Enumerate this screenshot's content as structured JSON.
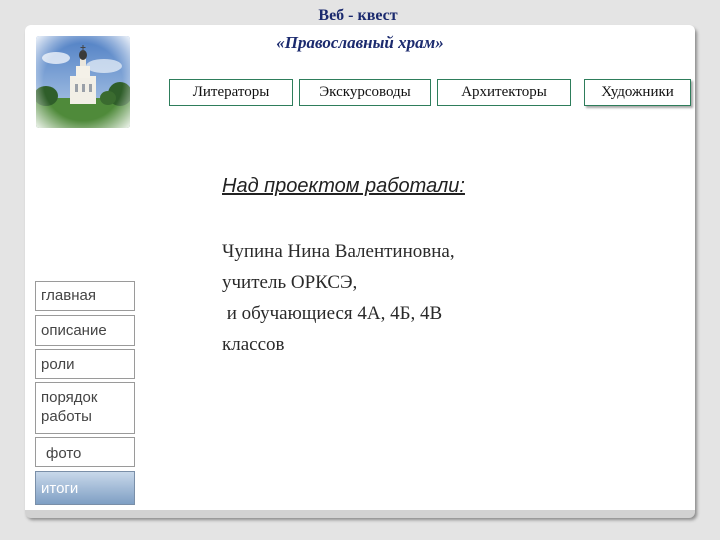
{
  "header": {
    "title": "Веб - квест",
    "subtitle": "«Православный храм»"
  },
  "roles": [
    {
      "label": "Литераторы"
    },
    {
      "label": "Экскурсоводы"
    },
    {
      "label": "Архитекторы"
    },
    {
      "label": "Художники"
    }
  ],
  "nav": [
    {
      "label": "главная"
    },
    {
      "label": "описание"
    },
    {
      "label": "роли"
    },
    {
      "label": "порядок работы"
    },
    {
      "label": "фото"
    },
    {
      "label": "итоги"
    }
  ],
  "content": {
    "heading": "Над проектом работали:",
    "lines": [
      "Чупина Нина Валентиновна,",
      "учитель ОРКСЭ,",
      " и обучающиеся 4А, 4Б, 4В",
      "классов"
    ]
  },
  "colors": {
    "title": "#1b2a6e",
    "role_border": "#2e7d5b",
    "nav_active": "#7f9fc4"
  },
  "icons": {
    "photo": "church-photo"
  }
}
